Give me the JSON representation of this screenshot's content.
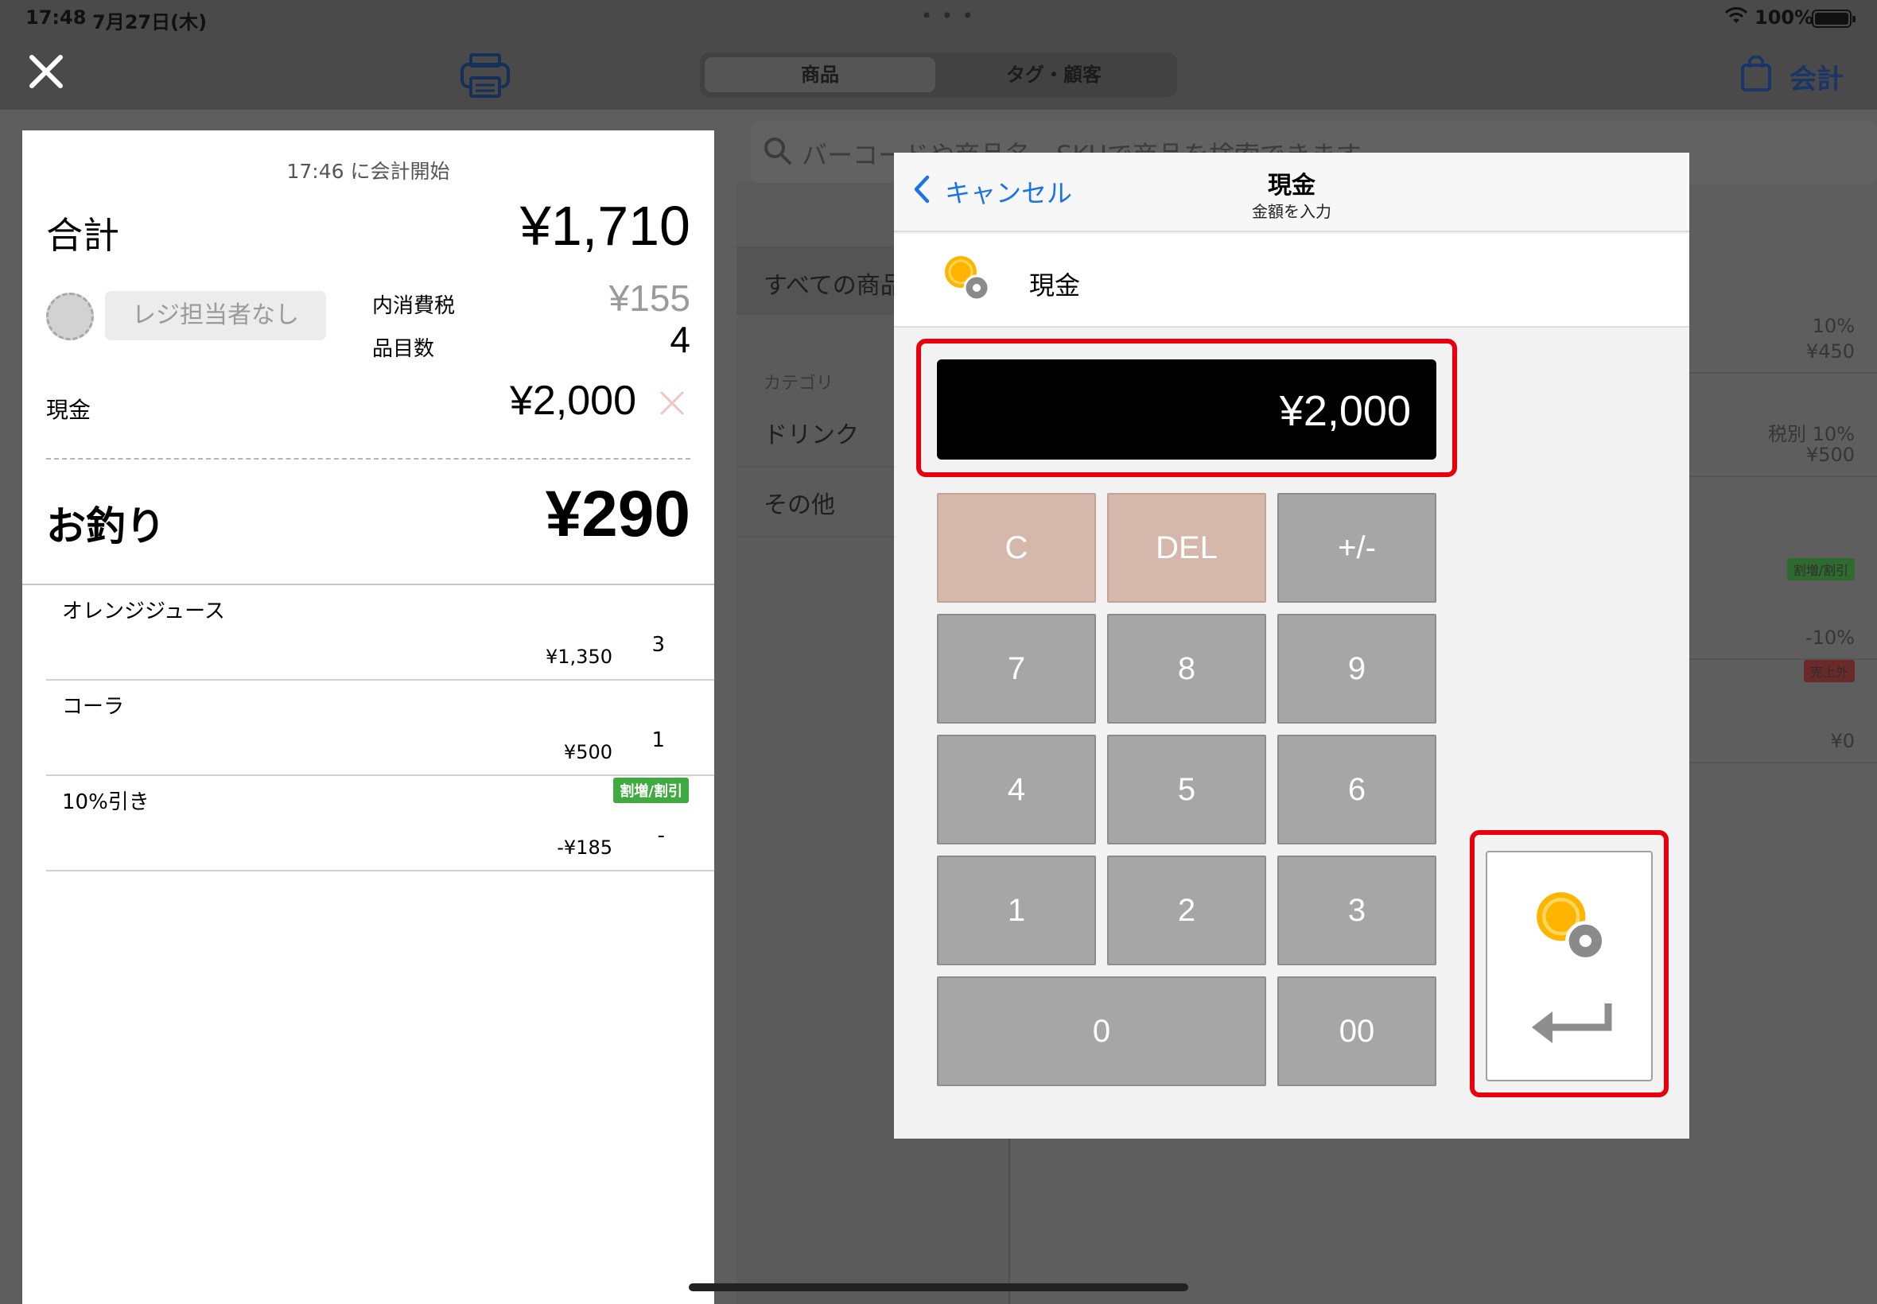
{
  "status_bar": {
    "time": "17:48",
    "date": "7月27日(木)",
    "battery": "100%"
  },
  "top_bar": {
    "tabs": [
      {
        "label": "商品"
      },
      {
        "label": "タグ・顧客"
      }
    ],
    "checkout_label": "会計"
  },
  "receipt": {
    "started_at": "17:46 に会計開始",
    "total_label": "合計",
    "total_value": "¥1,710",
    "staff_label": "レジ担当者なし",
    "tax_label": "内消費税",
    "tax_value": "¥155",
    "count_label": "品目数",
    "count_value": "4",
    "cash_label": "現金",
    "cash_value": "¥2,000",
    "change_label": "お釣り",
    "change_value": "¥290",
    "items": [
      {
        "name": "オレンジジュース",
        "price": "¥1,350",
        "qty": "3"
      },
      {
        "name": "コーラ",
        "price": "¥500",
        "qty": "1"
      },
      {
        "name": "10%引き",
        "price": "-¥185",
        "qty": "-",
        "badge": "割増/割引"
      }
    ]
  },
  "products": {
    "search_placeholder": "バーコードや商品名、SKUで商品を検索できます",
    "all_label": "すべての商品",
    "category_header": "カテゴリ",
    "categories": [
      {
        "name": "ドリンク"
      },
      {
        "name": "その他"
      }
    ],
    "rows": [
      {
        "line1": "10%",
        "line2": "¥450"
      },
      {
        "line1": "税別 10%",
        "line2": "¥500"
      },
      {
        "badge": "割増/割引",
        "line2": "-10%"
      },
      {
        "badge": "売上外",
        "line2": "¥0"
      }
    ]
  },
  "modal": {
    "cancel_label": "キャンセル",
    "title": "現金",
    "subtitle": "金額を入力",
    "method_label": "現金",
    "display_value": "¥2,000",
    "keys": {
      "clear": "C",
      "del": "DEL",
      "sign": "+/-",
      "k7": "7",
      "k8": "8",
      "k9": "9",
      "k4": "4",
      "k5": "5",
      "k6": "6",
      "k1": "1",
      "k2": "2",
      "k3": "3",
      "k0": "0",
      "k00": "00"
    }
  },
  "colors": {
    "accent_blue": "#1a73e8",
    "highlight_red": "#e8000c",
    "discount_green": "#3faa3f",
    "coin_gold": "#ffb400",
    "key_gray": "#a6a6a6",
    "key_pink": "#d5b8ab"
  },
  "icons": {
    "close": "close-icon",
    "printer": "printer-icon",
    "bag": "shopping-bag-icon",
    "coin": "coin-icon",
    "enter": "return-arrow-icon",
    "search": "search-icon",
    "back": "chevron-left-icon"
  }
}
